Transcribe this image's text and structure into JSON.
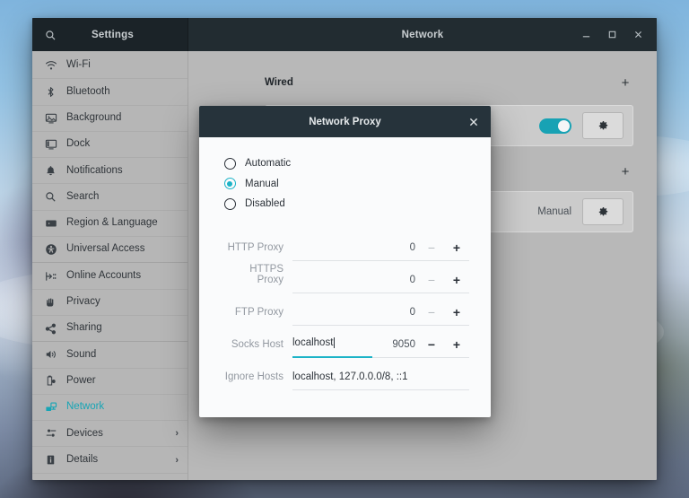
{
  "window": {
    "sidebar_title": "Settings",
    "content_title": "Network",
    "search_icon": "search-icon",
    "minimize_label": "—",
    "maximize_label": "□",
    "close_label": "✕"
  },
  "sidebar": {
    "items": [
      {
        "label": "Wi-Fi",
        "icon": "wifi-icon",
        "active": false,
        "chevron": ""
      },
      {
        "label": "Bluetooth",
        "icon": "bluetooth-icon",
        "active": false,
        "chevron": ""
      },
      {
        "label": "Background",
        "icon": "background-icon",
        "active": false,
        "chevron": ""
      },
      {
        "label": "Dock",
        "icon": "dock-icon",
        "active": false,
        "chevron": ""
      },
      {
        "label": "Notifications",
        "icon": "bell-icon",
        "active": false,
        "chevron": ""
      },
      {
        "label": "Search",
        "icon": "search-icon",
        "active": false,
        "chevron": ""
      },
      {
        "label": "Region & Language",
        "icon": "region-language-icon",
        "active": false,
        "chevron": ""
      },
      {
        "label": "Universal Access",
        "icon": "universal-access-icon",
        "active": false,
        "chevron": ""
      },
      {
        "label": "Online Accounts",
        "icon": "online-accounts-icon",
        "active": false,
        "chevron": ""
      },
      {
        "label": "Privacy",
        "icon": "privacy-hand-icon",
        "active": false,
        "chevron": ""
      },
      {
        "label": "Sharing",
        "icon": "sharing-icon",
        "active": false,
        "chevron": ""
      },
      {
        "label": "Sound",
        "icon": "sound-icon",
        "active": false,
        "chevron": ""
      },
      {
        "label": "Power",
        "icon": "power-battery-icon",
        "active": false,
        "chevron": ""
      },
      {
        "label": "Network",
        "icon": "network-icon",
        "active": true,
        "chevron": ""
      },
      {
        "label": "Devices",
        "icon": "devices-icon",
        "active": false,
        "chevron": "›"
      },
      {
        "label": "Details",
        "icon": "details-icon",
        "active": false,
        "chevron": "›"
      }
    ]
  },
  "content": {
    "wired_section_title": "Wired",
    "add_button_label": "+",
    "second_add_button_label": "+",
    "proxy_method_value": "Manual",
    "gear_icon": "gear-icon",
    "toggle_state": "on"
  },
  "dialog": {
    "title": "Network Proxy",
    "close_label": "✕",
    "modes": [
      {
        "label": "Automatic",
        "selected": false
      },
      {
        "label": "Manual",
        "selected": true
      },
      {
        "label": "Disabled",
        "selected": false
      }
    ],
    "fields": [
      {
        "label": "HTTP Proxy",
        "host": "",
        "port": "0",
        "focused": false,
        "minus": "−",
        "plus": "+"
      },
      {
        "label": "HTTPS Proxy",
        "host": "",
        "port": "0",
        "focused": false,
        "minus": "−",
        "plus": "+"
      },
      {
        "label": "FTP Proxy",
        "host": "",
        "port": "0",
        "focused": false,
        "minus": "−",
        "plus": "+"
      },
      {
        "label": "Socks Host",
        "host": "localhost",
        "port": "9050",
        "focused": true,
        "minus": "−",
        "plus": "+"
      }
    ],
    "ignore_hosts": {
      "label": "Ignore Hosts",
      "value": "localhost, 127.0.0.0/8, ::1"
    }
  },
  "colors": {
    "accent_teal": "#17a5b5",
    "titlebar_dark": "#1d2529",
    "dialog_titlebar": "#26333b",
    "sidebar_bg": "#b6b6b6",
    "content_bg": "#b8b8b8",
    "dialog_bg": "#fafbfc"
  }
}
